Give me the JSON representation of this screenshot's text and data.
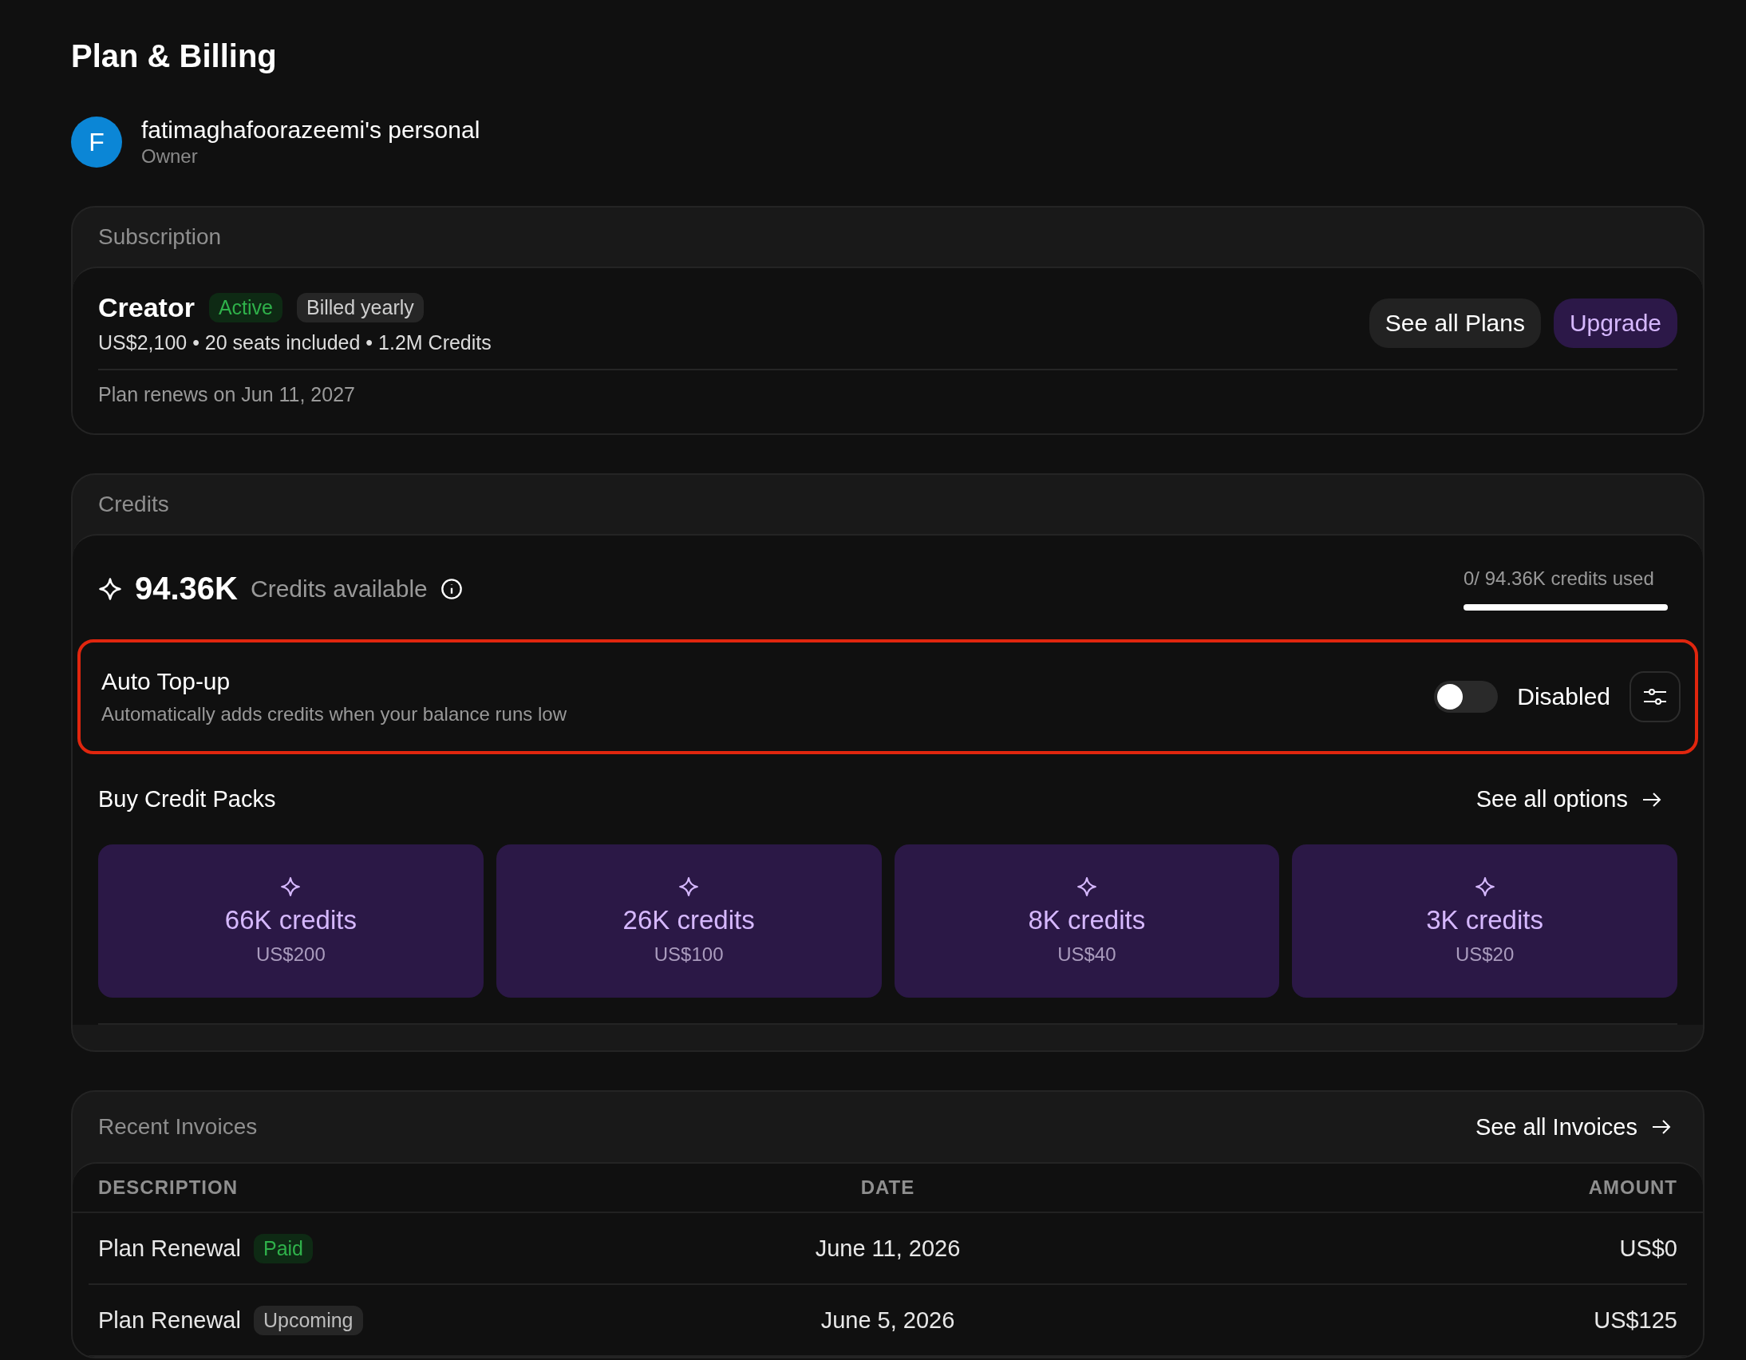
{
  "page_title": "Plan & Billing",
  "workspace": {
    "avatar_letter": "F",
    "name": "fatimaghafoorazeemi's personal",
    "role": "Owner"
  },
  "subscription": {
    "heading": "Subscription",
    "plan": "Creator",
    "badges": [
      {
        "label": "Active",
        "kind": "success"
      },
      {
        "label": "Billed yearly",
        "kind": "neutral"
      }
    ],
    "details": "US$2,100 • 20 seats included • 1.2M Credits",
    "buttons": [
      {
        "label": "See all Plans",
        "kind": "secondary"
      },
      {
        "label": "Upgrade",
        "kind": "primary"
      }
    ],
    "renewal": "Plan renews on Jun 11, 2027"
  },
  "credits": {
    "heading": "Credits",
    "amount": "94.36K",
    "amount_label": "Credits available",
    "usage_text": "0/ 94.36K credits used",
    "level": 1,
    "auto_topup": {
      "title": "Auto Top-up",
      "description": "Automatically adds credits when your balance runs low",
      "on": false,
      "status": "Disabled",
      "highlighted": true
    },
    "packs_heading": "Buy Credit Packs",
    "packs_link": "See all options",
    "packs": [
      {
        "credits": "66K credits",
        "price": "US$200"
      },
      {
        "credits": "26K credits",
        "price": "US$100"
      },
      {
        "credits": "8K credits",
        "price": "US$40"
      },
      {
        "credits": "3K credits",
        "price": "US$20"
      }
    ]
  },
  "invoices": {
    "heading": "Recent Invoices",
    "link": "See all Invoices",
    "columns": [
      "DESCRIPTION",
      "DATE",
      "AMOUNT"
    ],
    "rows": [
      {
        "description": "Plan Renewal",
        "status": "Paid",
        "kind": "success",
        "date": "June 11, 2026",
        "amount": "US$0"
      },
      {
        "description": "Plan Renewal",
        "status": "Upcoming",
        "kind": "neutral",
        "date": "June 5, 2026",
        "amount": "US$125"
      }
    ]
  }
}
